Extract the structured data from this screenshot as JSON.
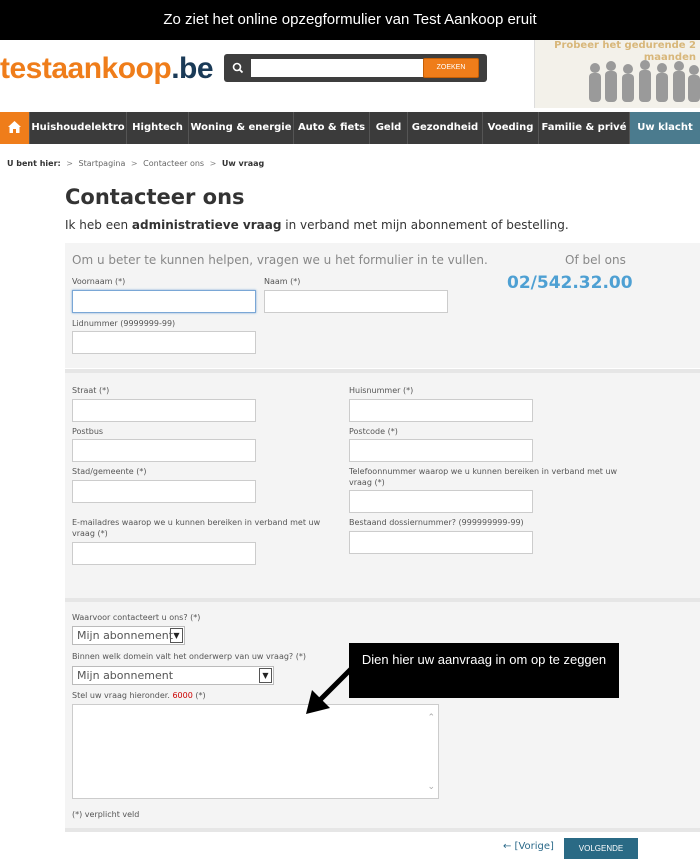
{
  "caption": "Zo ziet het online opzegformulier van Test Aankoop eruit",
  "logo": {
    "part1": "testaankoop",
    "part2": ".be"
  },
  "search": {
    "placeholder": "",
    "button": "ZOEKEN"
  },
  "promo": {
    "text": "Probeer het gedurende 2 maanden"
  },
  "nav": {
    "items": [
      "Huishoudelektro",
      "Hightech",
      "Woning & energie",
      "Auto & fiets",
      "Geld",
      "Gezondheid",
      "Voeding",
      "Familie & privé",
      "Uw klacht"
    ]
  },
  "breadcrumb": {
    "label": "U bent hier:",
    "items": [
      "Startpagina",
      "Contacteer ons",
      "Uw vraag"
    ]
  },
  "page": {
    "title": "Contacteer ons",
    "intro_pre": "Ik heb een ",
    "intro_bold": "administratieve vraag",
    "intro_post": " in verband met mijn abonnement of bestelling."
  },
  "section1": {
    "help": "Om u beter te kunnen helpen, vragen we u het formulier in te vullen.",
    "call_label": "Of bel ons",
    "phone": "02/542.32.00",
    "voornaam": "Voornaam (*)",
    "naam": "Naam (*)",
    "lidnummer": "Lidnummer (9999999-99)"
  },
  "section2": {
    "straat": "Straat (*)",
    "huisnummer": "Huisnummer (*)",
    "postbus": "Postbus",
    "postcode": "Postcode (*)",
    "stad": "Stad/gemeente (*)",
    "telefoon": "Telefoonnummer waarop we u kunnen bereiken in verband met uw vraag (*)",
    "email": "E-mailadres waarop we u kunnen bereiken in verband met uw vraag (*)",
    "dossier": "Bestaand dossiernummer? (999999999-99)"
  },
  "section3": {
    "reason_label": "Waarvoor contacteert u ons? (*)",
    "reason_value": "Mijn abonnement",
    "domain_label": "Binnen welk domein valt het onderwerp van uw vraag? (*)",
    "domain_value": "Mijn abonnement",
    "question_label": "Stel uw vraag hieronder.",
    "question_count": "6000",
    "question_req": "(*)",
    "footnote": "(*) verplicht veld"
  },
  "callout": "Dien hier uw aanvraag in om op te zeggen",
  "actions": {
    "prev": "← [Vorige]",
    "next": "VOLGENDE"
  },
  "colors": {
    "orange": "#ef7d1a",
    "navy": "#1a3a57",
    "phone_blue": "#4ea0d3",
    "button_teal": "#2a6a85"
  }
}
